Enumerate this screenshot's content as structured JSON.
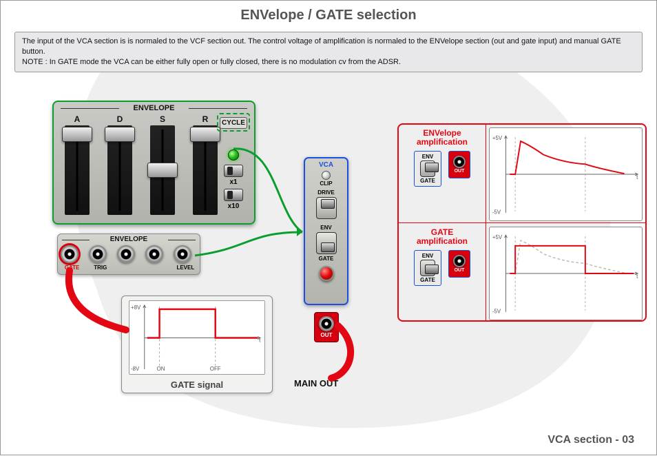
{
  "title": "ENVelope / GATE selection",
  "info": {
    "line1": "The input of the VCA section is is normaled to the VCF section out. The control voltage of amplification is normaled to the ENVelope section (out and gate input) and manual GATE button.",
    "line2": "NOTE : In GATE mode the VCA can be either fully open or fully closed, there is no modulation cv from the ADSR."
  },
  "envelope_panel": {
    "section": "ENVELOPE",
    "faders": [
      "A",
      "D",
      "S",
      "R"
    ],
    "cycle": "CYCLE",
    "mult1": "x1",
    "mult10": "x10"
  },
  "envelope_jacks": {
    "section": "ENVELOPE",
    "items": [
      {
        "label": "GATE",
        "red": true
      },
      {
        "label": "TRIG",
        "red": false
      },
      {
        "label": "",
        "red": false
      },
      {
        "label": "",
        "red": false
      },
      {
        "label": "LEVEL",
        "red": false
      }
    ]
  },
  "vca_panel": {
    "section": "VCA",
    "clip": "CLIP",
    "drive": "DRIVE",
    "env": "ENV",
    "gate": "GATE",
    "out": "OUT"
  },
  "main_out": "MAIN OUT",
  "compare": {
    "env_title1": "ENVelope",
    "env_title2": "amplification",
    "gate_title1": "GATE",
    "gate_title2": "amplification",
    "env": "ENV",
    "gate": "GATE",
    "out": "OUT"
  },
  "gate_chart": {
    "title": "GATE signal",
    "on": "ON",
    "off": "OFF",
    "yhi": "+8V",
    "ylo": "-8V",
    "t": "t"
  },
  "mini_axes": {
    "yhi": "+5V",
    "ylo": "-5V",
    "t": "t"
  },
  "footer": "VCA section - 03",
  "chart_data": [
    {
      "type": "line",
      "name": "GATE signal",
      "xlabel": "t",
      "ylabel": "V",
      "ylim": [
        -8,
        8
      ],
      "on_label": "ON",
      "off_label": "OFF",
      "series": [
        {
          "name": "gate",
          "x": [
            0,
            0.15,
            0.15,
            0.6,
            0.6,
            1.0
          ],
          "y": [
            0,
            0,
            8,
            8,
            0,
            0
          ]
        }
      ]
    },
    {
      "type": "line",
      "name": "ENVelope amplification",
      "xlabel": "t",
      "ylabel": "V",
      "ylim": [
        -5,
        5
      ],
      "series": [
        {
          "name": "envelope_out",
          "x": [
            0,
            0.08,
            0.12,
            0.25,
            0.6,
            0.62,
            1.0
          ],
          "y": [
            0,
            0,
            4.6,
            3.2,
            2.6,
            1.2,
            0
          ]
        }
      ],
      "gate_markers_x": [
        0.08,
        0.6
      ]
    },
    {
      "type": "line",
      "name": "GATE amplification",
      "xlabel": "t",
      "ylabel": "V",
      "ylim": [
        -5,
        5
      ],
      "series": [
        {
          "name": "gate_out",
          "x": [
            0,
            0.08,
            0.08,
            0.6,
            0.6,
            1.0
          ],
          "y": [
            0,
            0,
            3.8,
            3.8,
            0,
            0
          ]
        },
        {
          "name": "envelope_ghost",
          "dashed": true,
          "x": [
            0,
            0.08,
            0.12,
            0.25,
            0.6,
            0.62,
            1.0
          ],
          "y": [
            0,
            0,
            4.6,
            3.2,
            2.6,
            1.2,
            0
          ]
        }
      ],
      "gate_markers_x": [
        0.08,
        0.6
      ]
    }
  ]
}
